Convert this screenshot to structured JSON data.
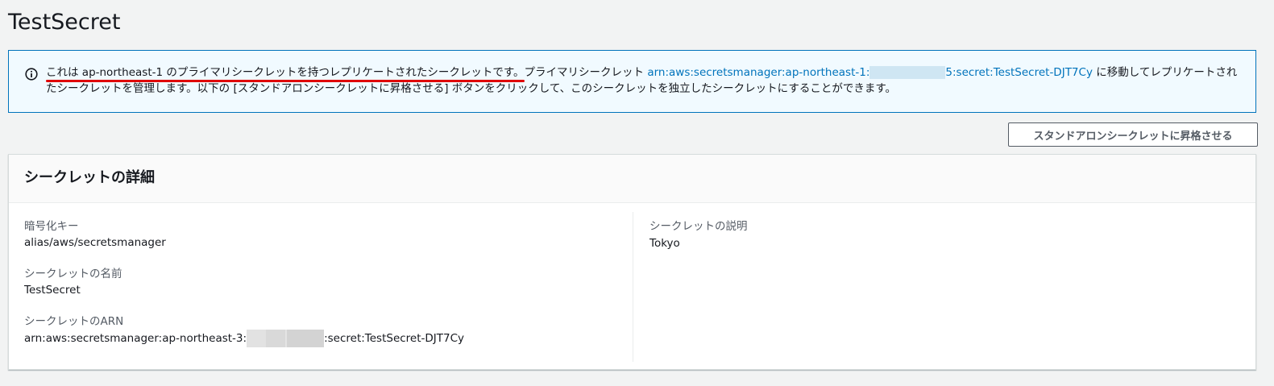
{
  "page": {
    "title": "TestSecret"
  },
  "banner": {
    "highlighted_text": "これは ap-northeast-1 のプライマリシークレットを持つレプリケートされたシークレットです。",
    "text_before_link": "プライマリシークレット ",
    "link_prefix": "arn:aws:secretsmanager:ap-northeast-1:",
    "link_suffix": "5:secret:TestSecret-DJT7Cy",
    "text_after_link": " に移動してレプリケートされたシークレットを管理します。以下の [スタンドアロンシークレットに昇格させる] ボタンをクリックして、このシークレットを独立したシークレットにすることができます。",
    "icon": "info-icon",
    "colors": {
      "border": "#0073bb",
      "background": "#f1faff",
      "link": "#0073bb",
      "annotation_underline": "#e00000"
    }
  },
  "actions": {
    "promote_label": "スタンドアロンシークレットに昇格させる"
  },
  "details": {
    "title": "シークレットの詳細",
    "left": [
      {
        "label": "暗号化キー",
        "value": "alias/aws/secretsmanager"
      },
      {
        "label": "シークレットの名前",
        "value": "TestSecret"
      },
      {
        "label": "シークレットのARN",
        "value_prefix": "arn:aws:secretsmanager:ap-northeast-3:",
        "value_suffix": ":secret:TestSecret-DJT7Cy"
      }
    ],
    "right": [
      {
        "label": "シークレットの説明",
        "value": "Tokyo"
      }
    ]
  }
}
